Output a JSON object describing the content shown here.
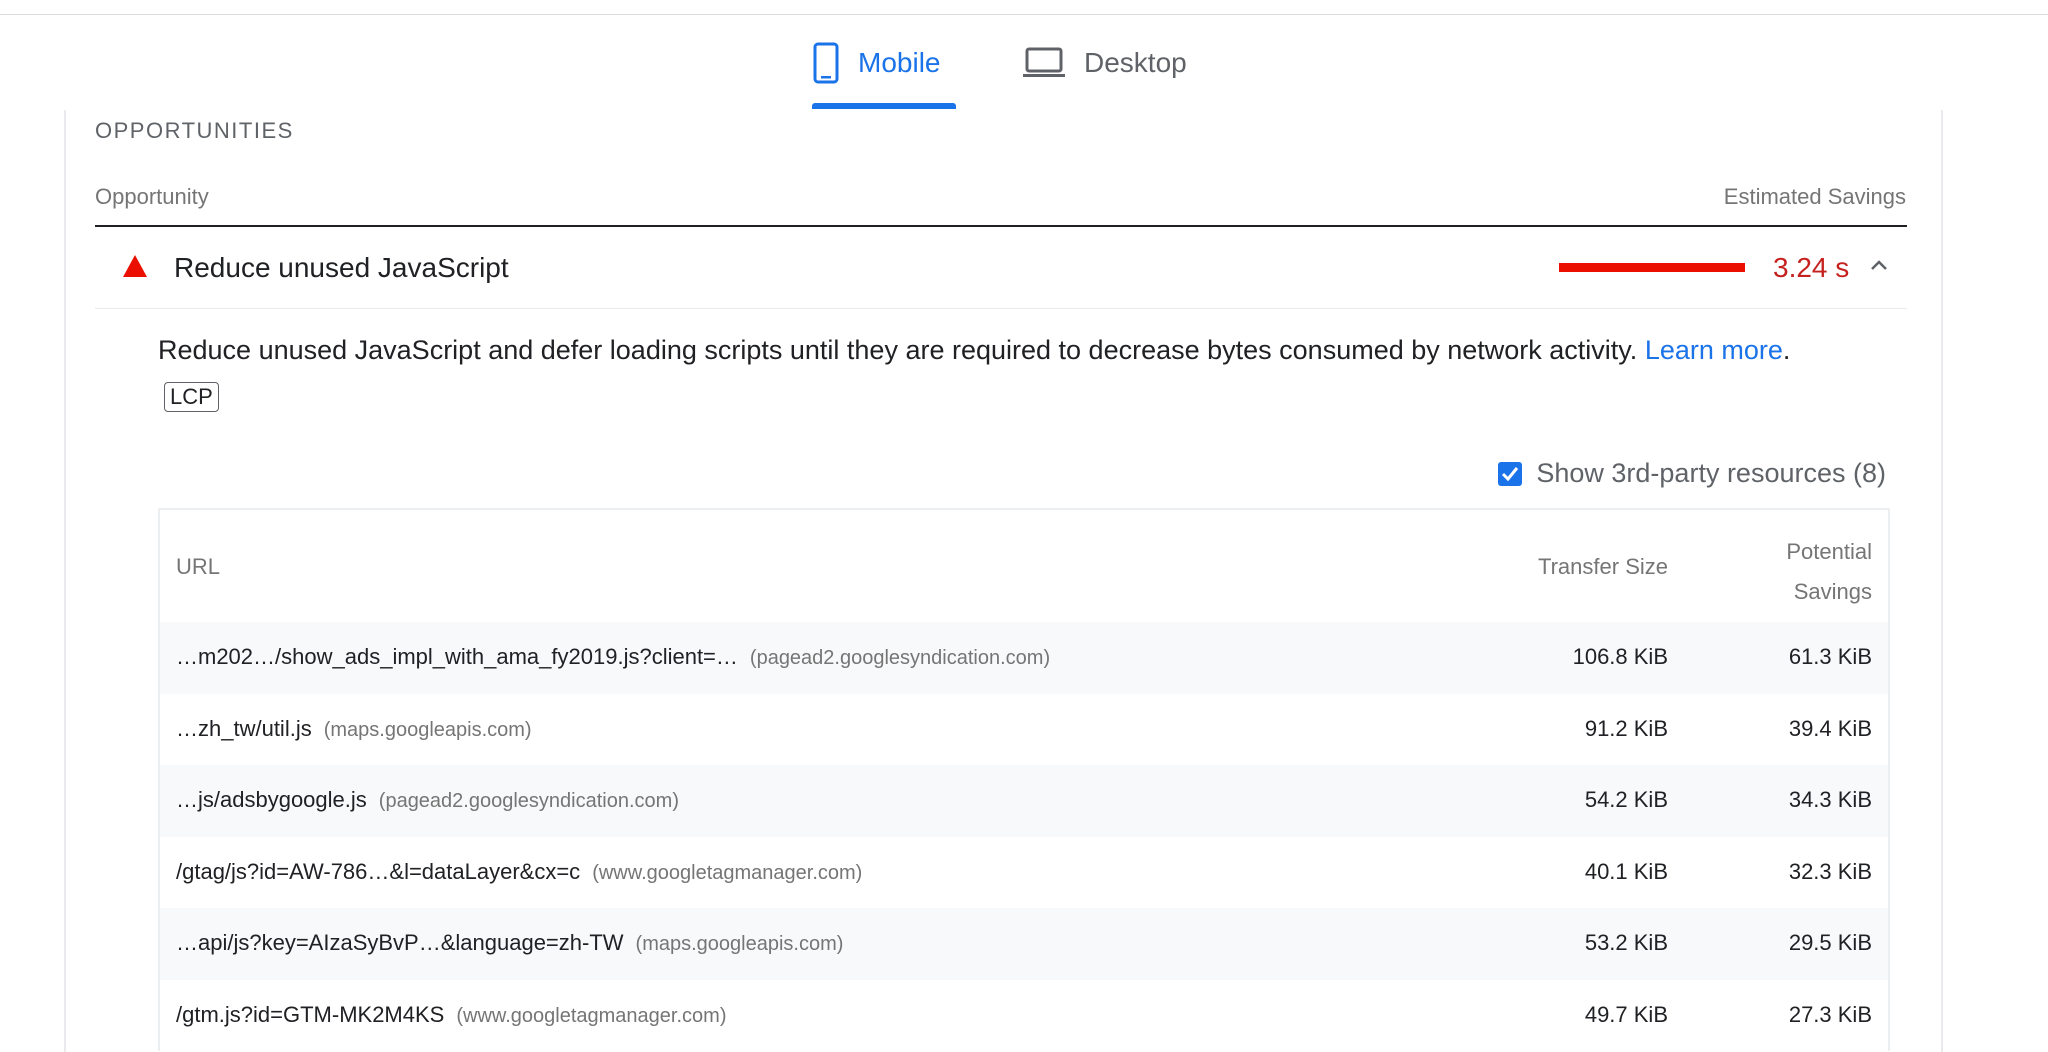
{
  "tabs": {
    "mobile": "Mobile",
    "desktop": "Desktop"
  },
  "section_title": "OPPORTUNITIES",
  "header": {
    "left": "Opportunity",
    "right": "Estimated Savings"
  },
  "audit": {
    "title": "Reduce unused JavaScript",
    "savings": "3.24 s",
    "description": "Reduce unused JavaScript and defer loading scripts until they are required to decrease bytes consumed by network activity.",
    "learn_more": "Learn more",
    "period": ".",
    "badge": "LCP"
  },
  "third_party": {
    "label": "Show 3rd-party resources (8)",
    "checked": true
  },
  "table": {
    "headers": {
      "url": "URL",
      "transfer_size": "Transfer Size",
      "potential_savings": "Potential Savings"
    },
    "rows": [
      {
        "url": "…m202…/show_ads_impl_with_ama_fy2019.js?client=…",
        "host": "(pagead2.googlesyndication.com)",
        "size": "106.8 KiB",
        "savings": "61.3 KiB"
      },
      {
        "url": "…zh_tw/util.js",
        "host": "(maps.googleapis.com)",
        "size": "91.2 KiB",
        "savings": "39.4 KiB"
      },
      {
        "url": "…js/adsbygoogle.js",
        "host": "(pagead2.googlesyndication.com)",
        "size": "54.2 KiB",
        "savings": "34.3 KiB"
      },
      {
        "url": "/gtag/js?id=AW-786…&l=dataLayer&cx=c",
        "host": "(www.googletagmanager.com)",
        "size": "40.1 KiB",
        "savings": "32.3 KiB"
      },
      {
        "url": "…api/js?key=AIzaSyBvP…&language=zh-TW",
        "host": "(maps.googleapis.com)",
        "size": "53.2 KiB",
        "savings": "29.5 KiB"
      },
      {
        "url": "/gtm.js?id=GTM-MK2M4KS",
        "host": "(www.googletagmanager.com)",
        "size": "49.7 KiB",
        "savings": "27.3 KiB"
      }
    ]
  },
  "colors": {
    "accent": "#1a73e8",
    "fail": "#eb0f00",
    "fail_text": "#c5221f"
  },
  "icons": {
    "mobile": "smartphone-icon",
    "desktop": "laptop-icon",
    "status": "warning-triangle-icon",
    "expand": "chevron-up-icon",
    "check": "checkmark-icon"
  }
}
